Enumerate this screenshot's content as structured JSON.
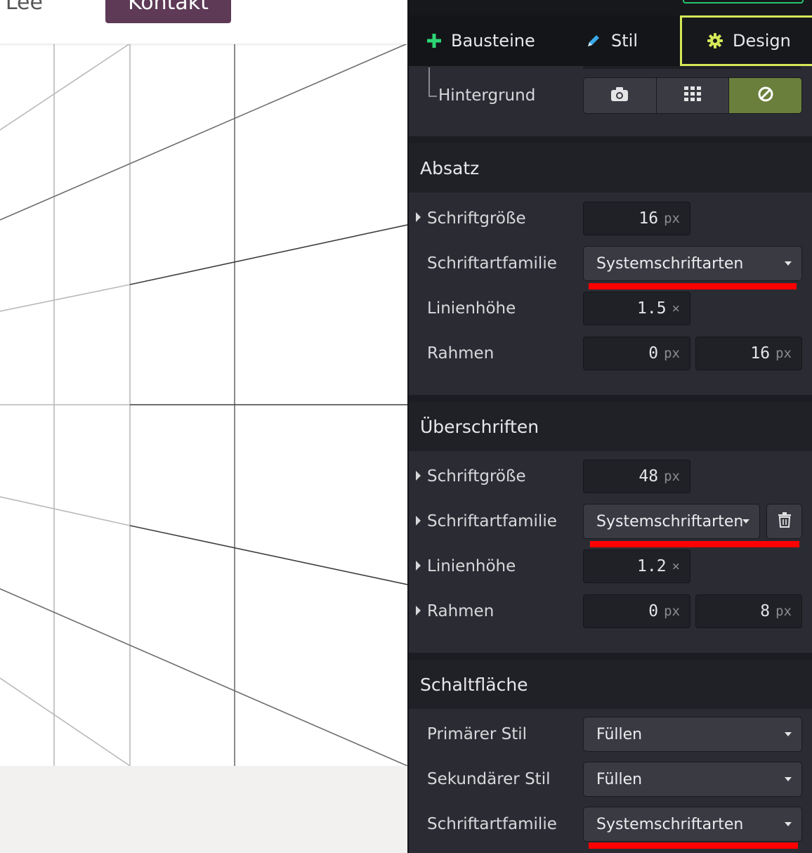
{
  "canvas": {
    "brand_text": "r Lee",
    "contact_label": "Kontakt"
  },
  "colors": {
    "panel_bg": "#2b2c33",
    "tab_active_border": "#d4e857",
    "plus_icon": "#2ed573",
    "pencil_icon": "#3aa9e6",
    "gear_icon": "#d4e857",
    "bg_active": "#6b7f3c",
    "annotation": "#ff0000",
    "contact_button": "#5e3a57"
  },
  "tabs": [
    {
      "label": "Bausteine",
      "icon": "plus-icon"
    },
    {
      "label": "Stil",
      "icon": "pencil-icon"
    },
    {
      "label": "Design",
      "icon": "gear-icon",
      "active": true
    }
  ],
  "background": {
    "label": "Hintergrund",
    "options": [
      "camera-icon",
      "grid-icon",
      "none-icon"
    ],
    "selected": "none-icon"
  },
  "paragraph": {
    "title": "Absatz",
    "font_size": {
      "label": "Schriftgröße",
      "value": "16",
      "unit": "px"
    },
    "font_family": {
      "label": "Schriftartfamilie",
      "value": "Systemschriftarten"
    },
    "line_height": {
      "label": "Linienhöhe",
      "value": "1.5",
      "unit": "×"
    },
    "border": {
      "label": "Rahmen",
      "value1": "0",
      "unit1": "px",
      "value2": "16",
      "unit2": "px"
    }
  },
  "headings": {
    "title": "Überschriften",
    "font_size": {
      "label": "Schriftgröße",
      "value": "48",
      "unit": "px"
    },
    "font_family": {
      "label": "Schriftartfamilie",
      "value": "Systemschriftarten"
    },
    "line_height": {
      "label": "Linienhöhe",
      "value": "1.2",
      "unit": "×"
    },
    "border": {
      "label": "Rahmen",
      "value1": "0",
      "unit1": "px",
      "value2": "8",
      "unit2": "px"
    }
  },
  "button": {
    "title": "Schaltfläche",
    "primary_style": {
      "label": "Primärer Stil",
      "value": "Füllen"
    },
    "secondary_style": {
      "label": "Sekundärer Stil",
      "value": "Füllen"
    },
    "font_family": {
      "label": "Schriftartfamilie",
      "value": "Systemschriftarten"
    }
  }
}
